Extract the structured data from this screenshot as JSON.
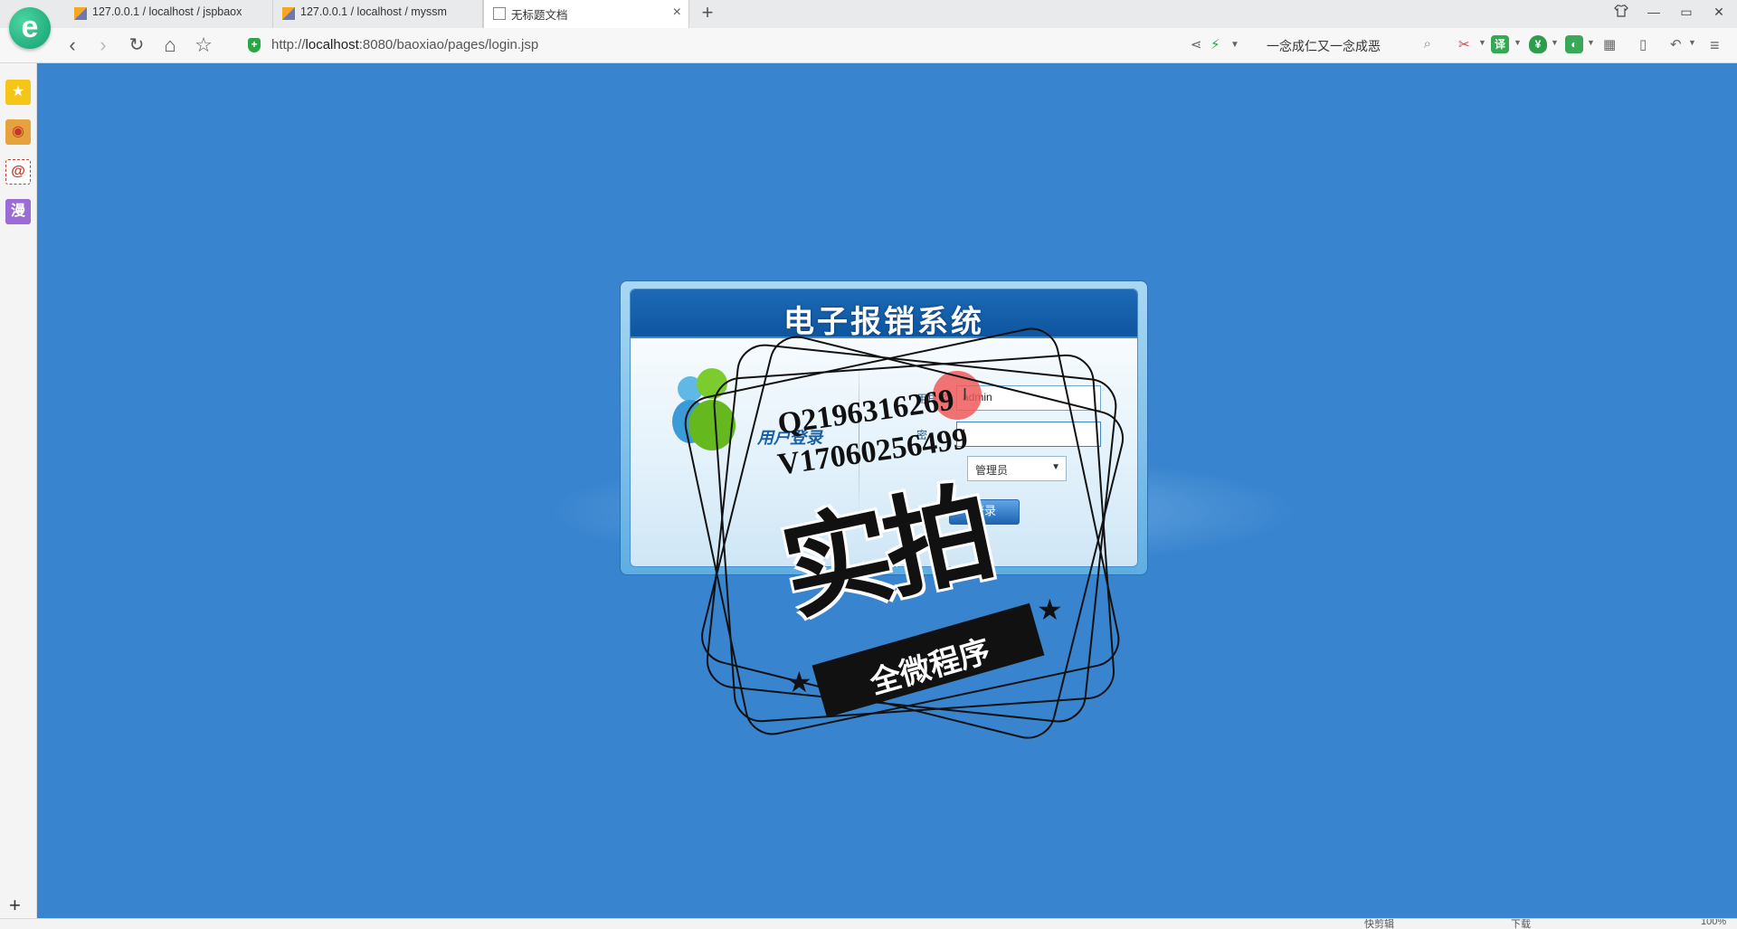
{
  "browser": {
    "logo_letter": "e",
    "tabs": [
      {
        "title": "127.0.0.1 / localhost / jspbaox",
        "favicon": "phpmyadmin-icon",
        "active": false
      },
      {
        "title": "127.0.0.1 / localhost / myssm",
        "favicon": "phpmyadmin-icon",
        "active": false
      },
      {
        "title": "无标题文档",
        "favicon": "document-icon",
        "active": true,
        "close": "×"
      }
    ],
    "new_tab": "+",
    "window_controls": {
      "shirt": "skin-icon",
      "minimize": "—",
      "restore": "▭",
      "close": "✕"
    }
  },
  "navbar": {
    "back": "‹",
    "forward": "›",
    "refresh": "↻",
    "home": "⌂",
    "star": "☆",
    "url_host_prefix": "http://",
    "url_host": "localhost",
    "url_rest": ":8080/baoxiao/pages/login.jsp",
    "search_text": "一念成仁又一念成恶",
    "icons": [
      "share-icon",
      "lightning-icon",
      "chevron-down-icon",
      "search-icon",
      "scissors-icon",
      "translate-icon",
      "security-icon",
      "game-icon",
      "apps-icon",
      "tablet-icon",
      "undo-icon",
      "menu-icon"
    ]
  },
  "sidebar": {
    "items": [
      {
        "name": "favorites-icon",
        "glyph": "★",
        "color": "#f5c518"
      },
      {
        "name": "weibo-icon",
        "glyph": "◉",
        "color": "#e6a23c"
      },
      {
        "name": "email-icon",
        "glyph": "@",
        "color": "#ffffff"
      },
      {
        "name": "comic-icon",
        "glyph": "漫",
        "color": "#9b6cd6"
      }
    ],
    "add": "+"
  },
  "login": {
    "system_title": "电子报销系统",
    "caption": "用户登录",
    "username_label": "用户名",
    "username_value": "admin",
    "password_label": "密",
    "password_value": "|",
    "role_value": "管理员",
    "role_arrow": "▼",
    "login_button": "登录"
  },
  "watermark": {
    "line1": "Q2196316269",
    "line2": "V17060256499",
    "big": "实拍",
    "banner": "全微程序"
  },
  "statusbar": {
    "items": [
      "快剪辑",
      "下载",
      "100%"
    ]
  },
  "colors": {
    "page_bg": "#3884cf",
    "header_blue": "#0f55a0",
    "cursor_highlight": "#f05a5a"
  }
}
